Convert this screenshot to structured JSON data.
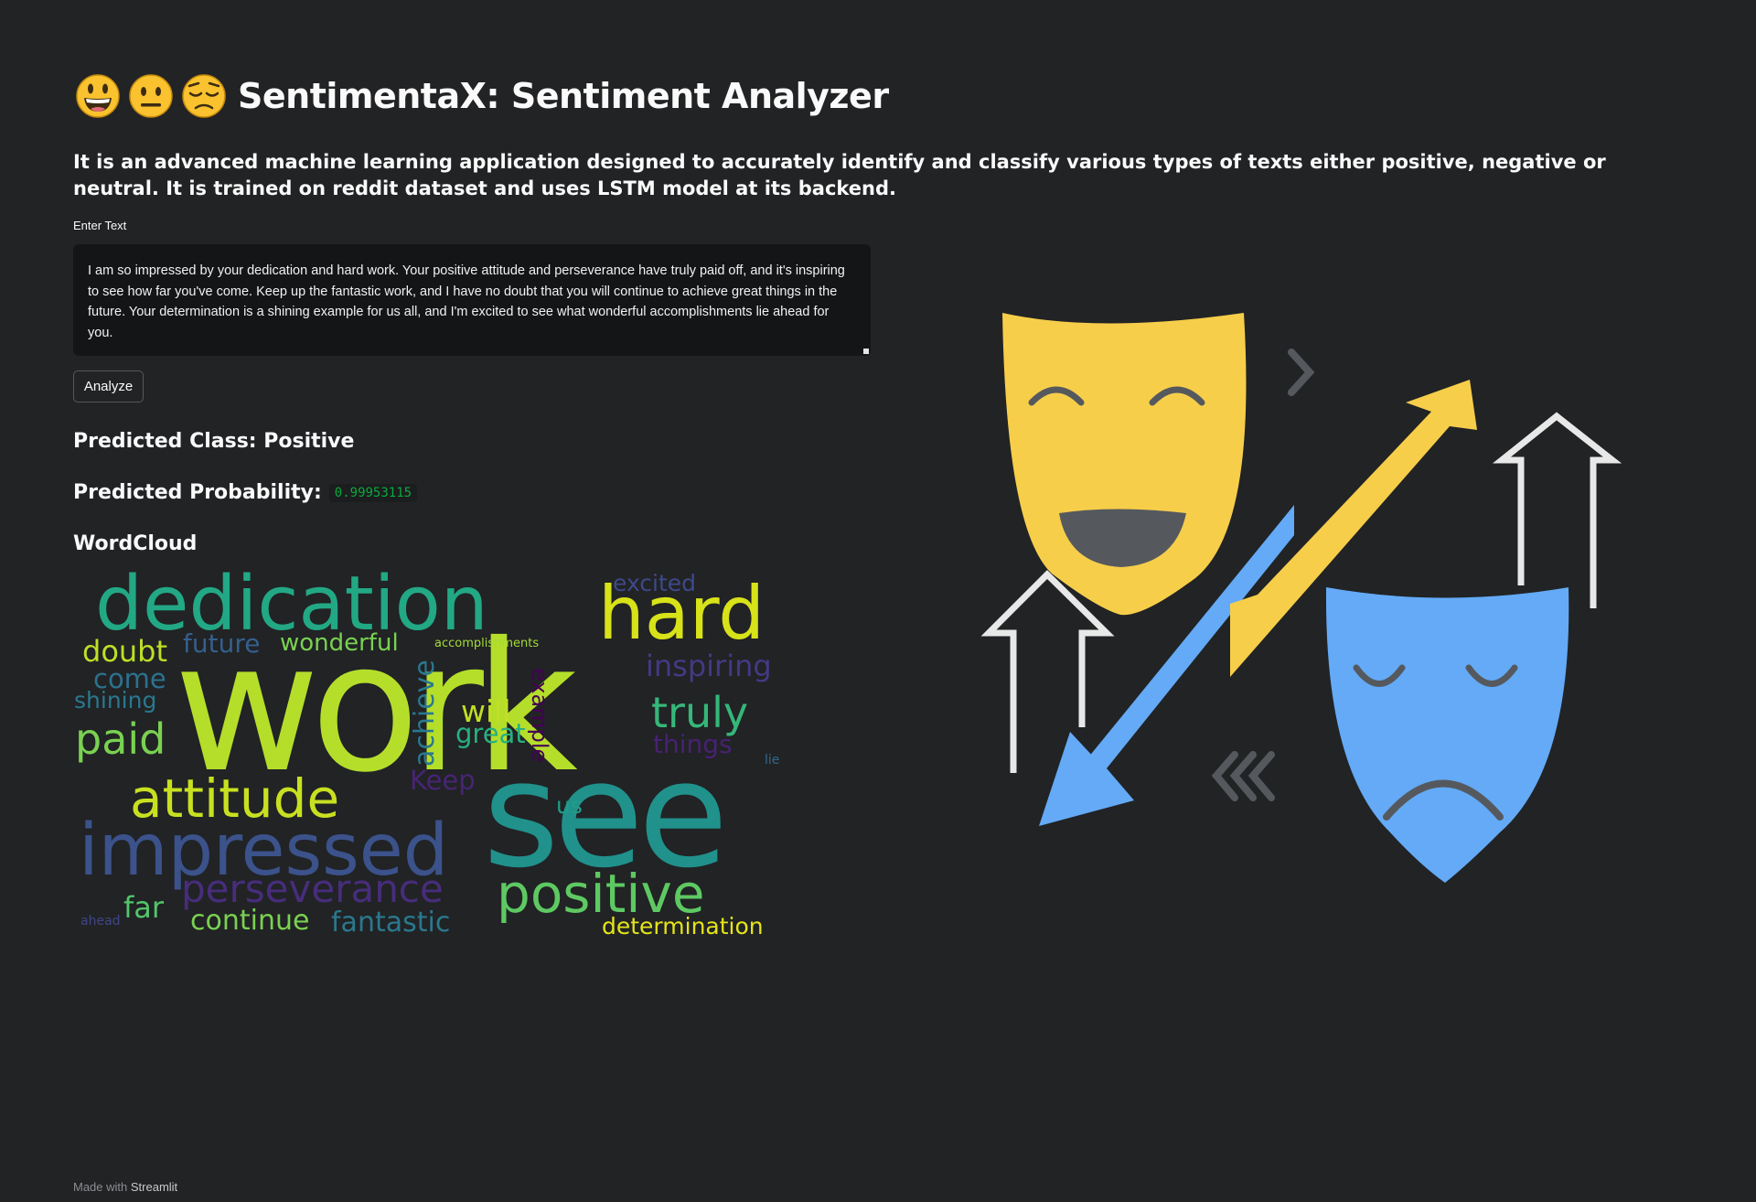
{
  "header": {
    "emoji_names": [
      "grinning-face-icon",
      "neutral-face-icon",
      "pensive-face-icon"
    ],
    "title": "SentimentaX: Sentiment Analyzer",
    "description": "It is an advanced machine learning application designed to accurately identify and classify various types of texts either positive, negative or neutral. It is trained on reddit dataset and uses LSTM model at its backend."
  },
  "input": {
    "label": "Enter Text",
    "value": "I am so impressed by your dedication and hard work. Your positive attitude and perseverance have truly paid off, and it's inspiring to see how far you've come. Keep up the fantastic work, and I have no doubt that you will continue to achieve great things in the future. Your determination is a shining example for us all, and I'm excited to see what wonderful accomplishments lie ahead for you."
  },
  "analyze_button": {
    "label": "Analyze"
  },
  "results": {
    "class_label": "Predicted Class: Positive",
    "probability_label": "Predicted Probability:",
    "probability_value": "0.99953115",
    "wordcloud_label": "WordCloud"
  },
  "wordcloud": {
    "words": [
      {
        "text": "work",
        "color": "#b5de2b"
      },
      {
        "text": "see",
        "color": "#21918c"
      },
      {
        "text": "dedication",
        "color": "#22a884"
      },
      {
        "text": "hard",
        "color": "#d8e219"
      },
      {
        "text": "impressed",
        "color": "#3b528b"
      },
      {
        "text": "attitude",
        "color": "#c8e020"
      },
      {
        "text": "positive",
        "color": "#5ec962"
      },
      {
        "text": "perseverance",
        "color": "#472d7b"
      },
      {
        "text": "paid",
        "color": "#7ad151"
      },
      {
        "text": "truly",
        "color": "#35b779"
      },
      {
        "text": "inspiring",
        "color": "#443983"
      },
      {
        "text": "excited",
        "color": "#3e4989"
      },
      {
        "text": "example",
        "color": "#440154"
      },
      {
        "text": "doubt",
        "color": "#bddf26"
      },
      {
        "text": "future",
        "color": "#355f8d"
      },
      {
        "text": "wonderful",
        "color": "#7ad151"
      },
      {
        "text": "accomplishments",
        "color": "#a5db36"
      },
      {
        "text": "come",
        "color": "#2c728e"
      },
      {
        "text": "shining",
        "color": "#2a788e"
      },
      {
        "text": "achieve",
        "color": "#2a788e"
      },
      {
        "text": "will",
        "color": "#c2df23"
      },
      {
        "text": "great",
        "color": "#29af7f"
      },
      {
        "text": "things",
        "color": "#482173"
      },
      {
        "text": "Keep",
        "color": "#482475"
      },
      {
        "text": "lie",
        "color": "#31688e"
      },
      {
        "text": "us",
        "color": "#1f9e89"
      },
      {
        "text": "far",
        "color": "#52c569"
      },
      {
        "text": "continue",
        "color": "#7ad151"
      },
      {
        "text": "fantastic",
        "color": "#2a788e"
      },
      {
        "text": "determination",
        "color": "#e5e419"
      },
      {
        "text": "ahead",
        "color": "#404688"
      }
    ]
  },
  "colors": {
    "background": "#212325",
    "mask_happy": "#f7ce4a",
    "mask_sad": "#64aaf6",
    "arrow_outline": "#e8e8e8",
    "feature_dark": "#55595e"
  },
  "footer": {
    "prefix": "Made with",
    "brand": "Streamlit"
  }
}
